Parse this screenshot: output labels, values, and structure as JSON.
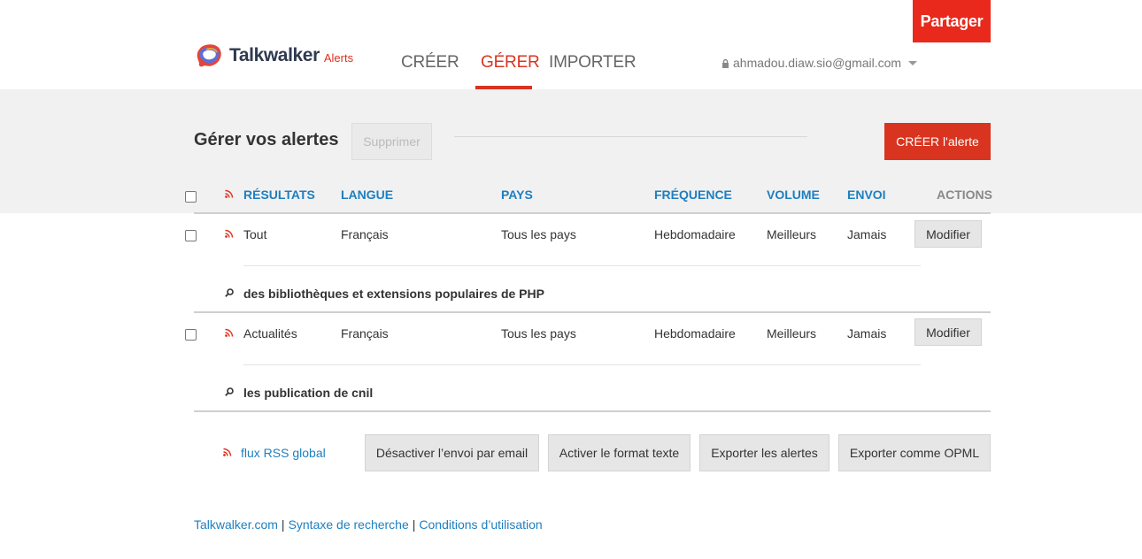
{
  "header": {
    "share_label": "Partager",
    "brand": "Talkwalker",
    "brand_suffix": "Alerts",
    "tabs": [
      {
        "label": "CRÉER"
      },
      {
        "label": "GÉRER"
      },
      {
        "label": "IMPORTER"
      }
    ],
    "active_tab": "GÉRER",
    "account_email": "ahmadou.diaw.sio@gmail.com"
  },
  "manage": {
    "title": "Gérer vos alertes",
    "delete_label": "Supprimer",
    "create_alert_label": "CRÉER l'alerte"
  },
  "table": {
    "columns": [
      "RÉSULTATS",
      "LANGUE",
      "PAYS",
      "FRÉQUENCE",
      "VOLUME",
      "ENVOI",
      "ACTIONS"
    ],
    "rows": [
      {
        "results": "Tout",
        "language": "Français",
        "country": "Tous les pays",
        "frequency": "Hebdomadaire",
        "volume": "Meilleurs",
        "delivery": "Jamais",
        "action_label": "Modifier",
        "query": "des bibliothèques et extensions populaires de PHP"
      },
      {
        "results": "Actualités",
        "language": "Français",
        "country": "Tous les pays",
        "frequency": "Hebdomadaire",
        "volume": "Meilleurs",
        "delivery": "Jamais",
        "action_label": "Modifier",
        "query": "les publication de cnil"
      }
    ]
  },
  "bottom": {
    "rss_global": "flux RSS global",
    "actions": [
      "Désactiver l’envoi par email",
      "Activer le format texte",
      "Exporter les alertes",
      "Exporter comme OPML"
    ]
  },
  "footer": {
    "links": [
      "Talkwalker.com",
      "Syntaxe de recherche",
      "Conditions d’utilisation"
    ],
    "separator": "|"
  },
  "colors": {
    "accent_red": "#d9341f",
    "link_blue": "#1e7fbf",
    "band_grey": "#f1f1f1"
  }
}
